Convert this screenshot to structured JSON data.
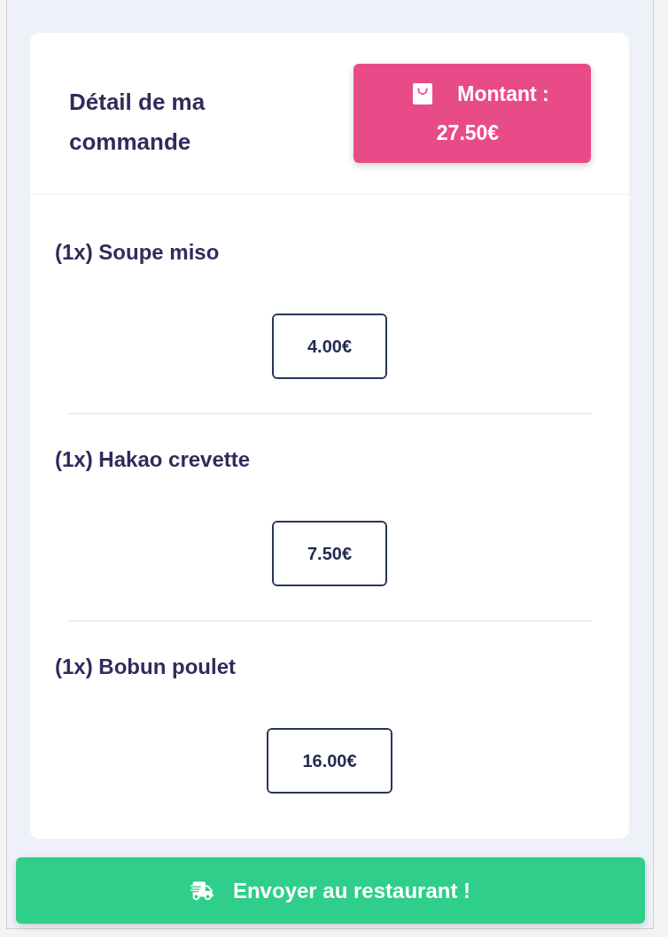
{
  "order": {
    "title": "Détail de ma commande",
    "amount": {
      "label": "Montant :",
      "value": "27.50€"
    }
  },
  "items": [
    {
      "label": "(1x) Soupe miso",
      "price": "4.00€"
    },
    {
      "label": "(1x) Hakao crevette",
      "price": "7.50€"
    },
    {
      "label": "(1x) Bobun poulet",
      "price": "16.00€"
    }
  ],
  "send_button": {
    "label": "Envoyer au restaurant !"
  }
}
